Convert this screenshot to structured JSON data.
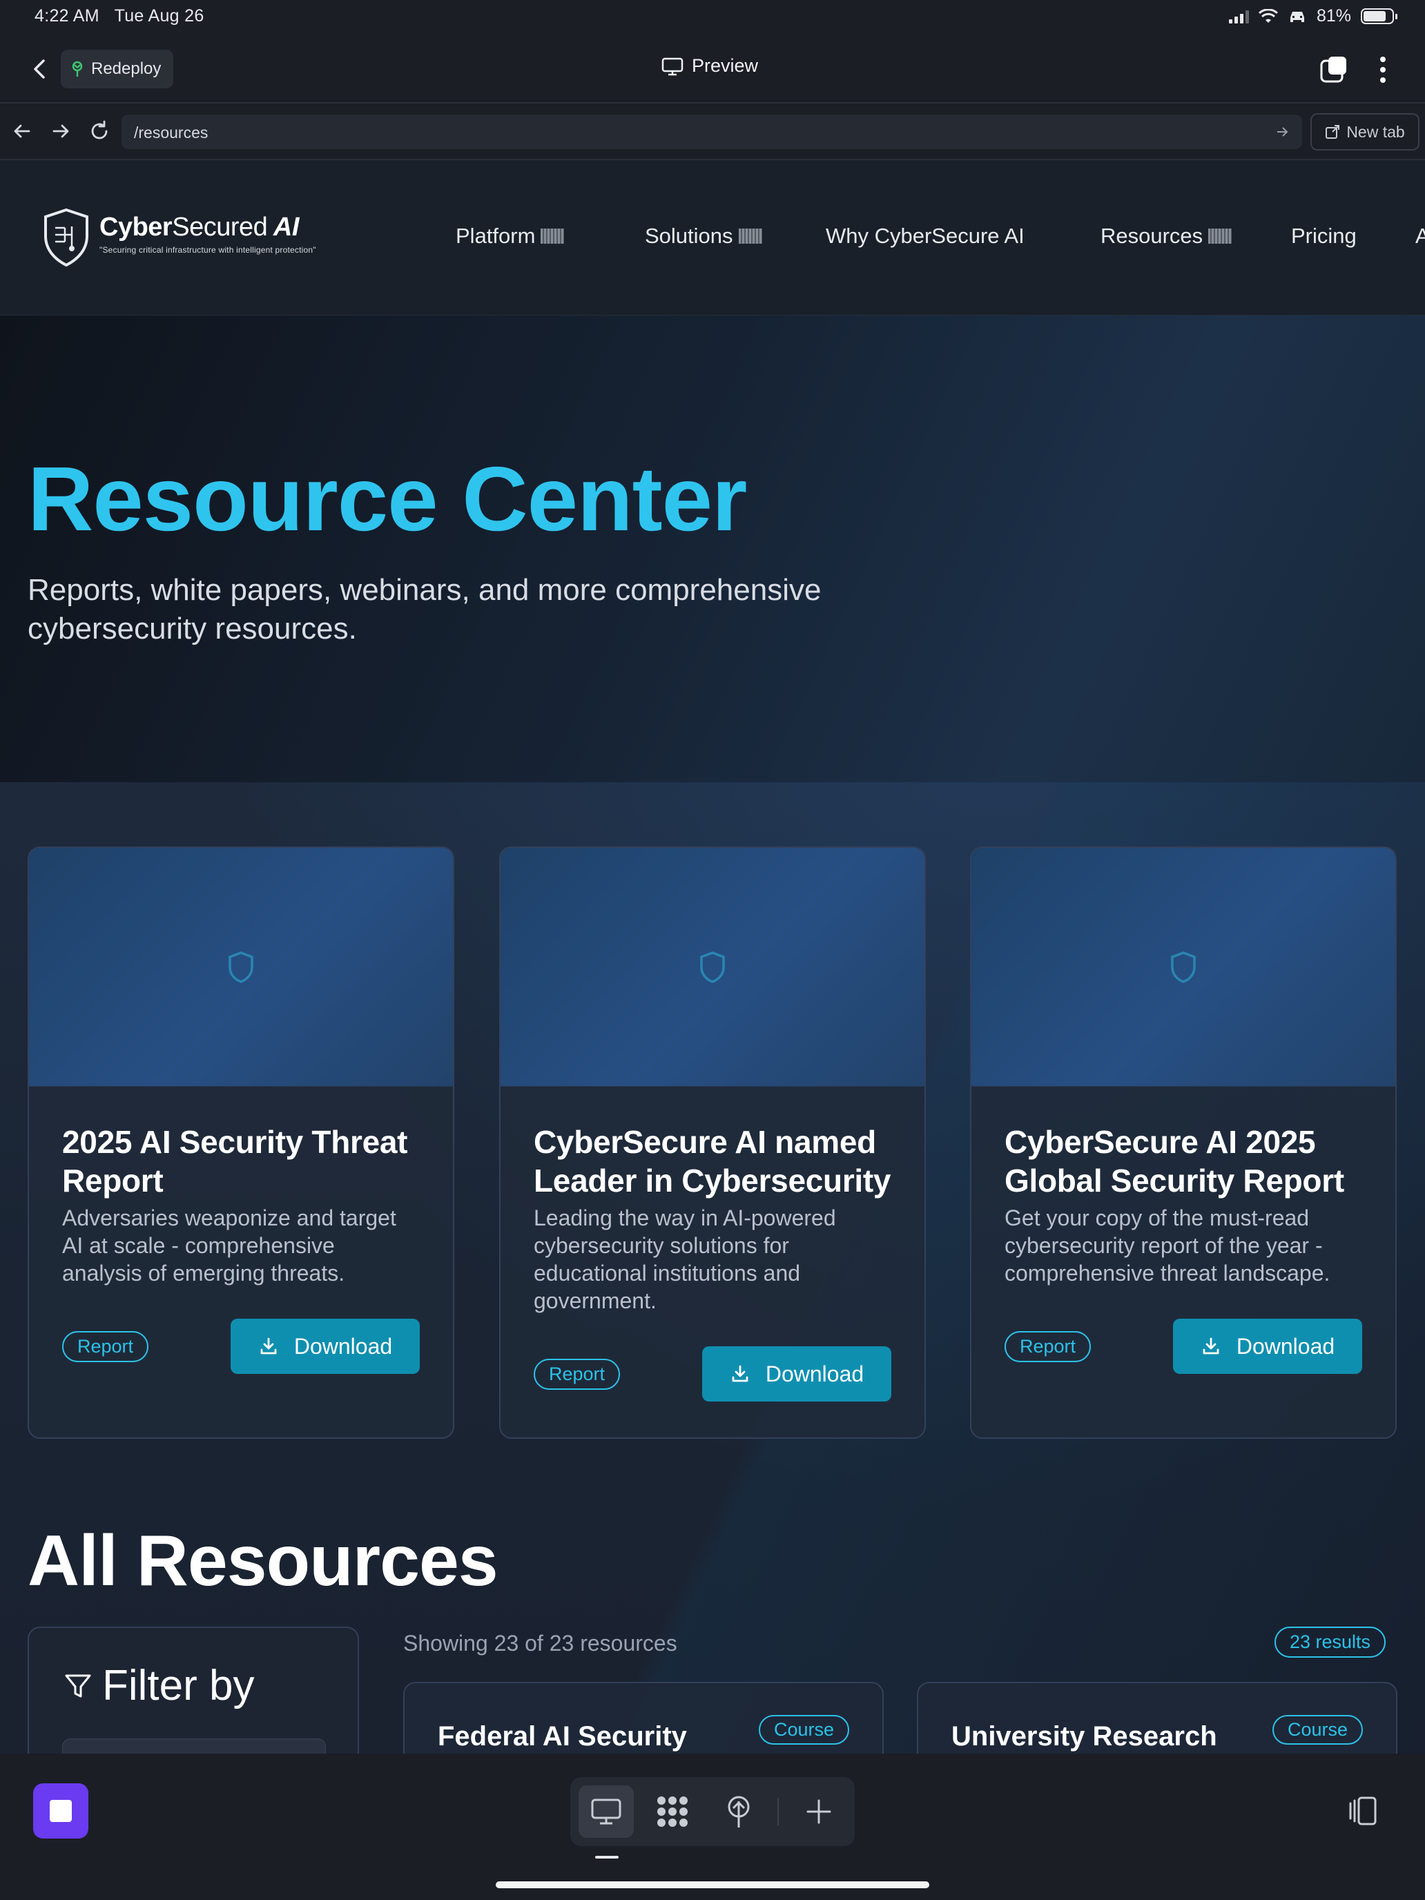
{
  "status": {
    "time": "4:22 AM",
    "date": "Tue Aug 26",
    "battery": "81%",
    "battery_level": 0.81
  },
  "appbar": {
    "redeploy_label": "Redeploy",
    "preview_label": "Preview"
  },
  "urlbar": {
    "url": "/resources",
    "new_tab_label": "New tab"
  },
  "site": {
    "logo": {
      "name_bold": "Cyber",
      "name_thin": "Secured",
      "name_ai": " AI",
      "tagline": "\"Securing critical infrastructure with intelligent protection\""
    },
    "nav": [
      "Platform",
      "Solutions",
      "Why CyberSecure AI",
      "Resources",
      "Pricing",
      "A"
    ],
    "hero": {
      "title": "Resource Center",
      "subtitle": "Reports, white papers, webinars, and more comprehensive cybersecurity resources."
    },
    "featured": [
      {
        "title": "2025 AI Security Threat Report",
        "description": "Adversaries weaponize and target AI at scale - comprehensive analysis of emerging threats.",
        "tag": "Report",
        "button": "Download"
      },
      {
        "title": "CyberSecure AI named Leader in Cybersecurity",
        "description": "Leading the way in AI-powered cybersecurity solutions for educational institutions and government.",
        "tag": "Report",
        "button": "Download"
      },
      {
        "title": "CyberSecure AI 2025 Global Security Report",
        "description": "Get your copy of the must-read cybersecurity report of the year - comprehensive threat landscape.",
        "tag": "Report",
        "button": "Download"
      }
    ],
    "all_resources": {
      "title": "All Resources",
      "filter_title": "Filter by",
      "showing": "Showing 23 of 23 resources",
      "results_badge": "23 results",
      "items": [
        {
          "title": "Federal AI Security",
          "tag": "Course"
        },
        {
          "title": "University Research",
          "tag": "Course"
        }
      ]
    }
  },
  "colors": {
    "accent": "#2fc4ee",
    "button": "#0f8fb0",
    "stop": "#6a3bf0"
  }
}
